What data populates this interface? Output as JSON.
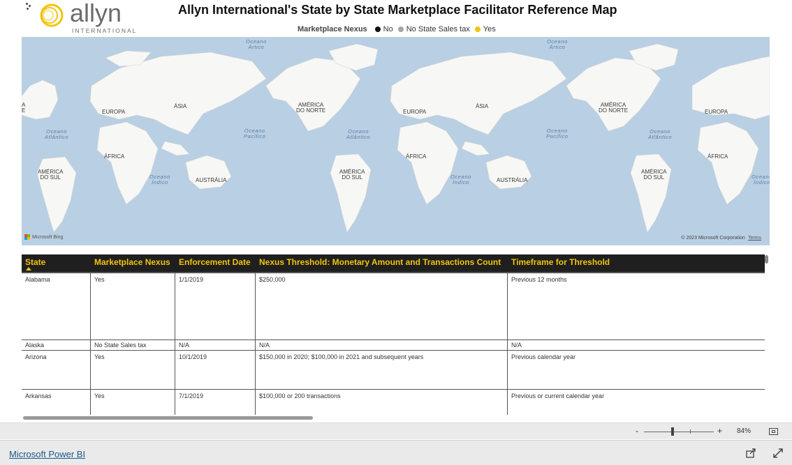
{
  "header": {
    "logo_word": "allyn",
    "logo_sub": "INTERNATIONAL",
    "title": "Allyn International's State by State Marketplace Facilitator Reference Map"
  },
  "legend": {
    "title": "Marketplace Nexus",
    "items": [
      {
        "label": "No",
        "color": "#111111"
      },
      {
        "label": "No State Sales tax",
        "color": "#a6a6a6"
      },
      {
        "label": "Yes",
        "color": "#f2c40e"
      }
    ]
  },
  "map": {
    "continents": [
      "EUROPA",
      "ÁSIA",
      "AMÉRICA DO NORTE",
      "ÁFRICA",
      "AMÉRICA DO SUL",
      "AUSTRÁLIA"
    ],
    "oceans": [
      "Oceano Ártico",
      "Oceano Atlântico",
      "Oceano Pacífico",
      "Oceano Índico"
    ],
    "bing_label": "Microsoft Bing",
    "copyright": "© 2023 Microsoft Corporation",
    "terms": "Terms"
  },
  "table": {
    "columns": [
      "State",
      "Marketplace Nexus",
      "Enforcement Date",
      "Nexus Threshold: Monetary Amount and Transactions Count",
      "Timeframe for Threshold"
    ],
    "rows": [
      [
        "Alabama",
        "Yes",
        "1/1/2019",
        "$250,000",
        "Previous 12 months"
      ],
      [
        "Alaska",
        "No State Sales tax",
        "N/A",
        "N/A",
        "N/A"
      ],
      [
        "Arizona",
        "Yes",
        "10/1/2019",
        "$150,000 in 2020; $100,000 in 2021 and subsequent years",
        "Previous calendar year"
      ],
      [
        "Arkansas",
        "Yes",
        "7/1/2019",
        "$100,000 or 200 transactions",
        "Previous or current calendar year"
      ]
    ]
  },
  "zoom": {
    "minus": "-",
    "plus": "+",
    "level": "84%"
  },
  "footer": {
    "link": "Microsoft Power BI"
  }
}
